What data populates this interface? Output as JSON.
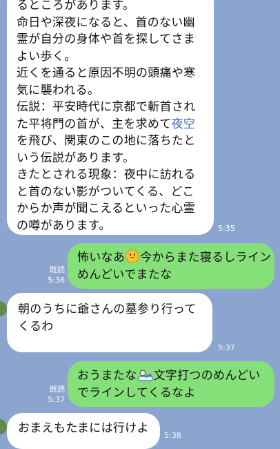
{
  "messages": [
    {
      "from": "them",
      "lines": [
        "るところがあります。",
        "命日や深夜になると、首のない幽",
        "霊が自分の身体や首を探してさま",
        "よい歩く。",
        "近くを通ると原因不明の頭痛や寒",
        "気に襲われる。",
        "伝説：平安時代に京都で斬首され",
        "た平将門の首が、主を求めて",
        "を飛び、関東のこの地に落ちたと",
        "いう伝説があります。",
        "きたとされる現象：夜中に訪れる",
        "と首のない影がついてくる、どこ",
        "からか声が聞こえるといった心霊",
        "の噂があります。"
      ],
      "link_text": "夜空",
      "time": "5:35"
    },
    {
      "from": "me",
      "line1_a": "怖いなあ",
      "line1_b": "今からまた寝るしライ",
      "line1_c": "ン",
      "line2": "めんどいでまたな",
      "read": "既読",
      "time": "5:36",
      "emoji": "worried-face"
    },
    {
      "from": "them",
      "lines": [
        "朝のうちに爺さんの墓参り行って",
        "くるわ"
      ],
      "time": "5:37"
    },
    {
      "from": "me",
      "line1_a": "おうまたな",
      "line1_b": "文字打つのめんどい",
      "line2": "でラインしてくるなよ",
      "read": "既読",
      "time": "5:37",
      "emoji": "person-lying-sticker"
    },
    {
      "from": "them",
      "lines": [
        "おまえもたまには行けよ"
      ],
      "time": "5:38"
    }
  ],
  "colors": {
    "background": "#8ba5ce",
    "incoming": "#ffffff",
    "outgoing": "#86e07a"
  }
}
